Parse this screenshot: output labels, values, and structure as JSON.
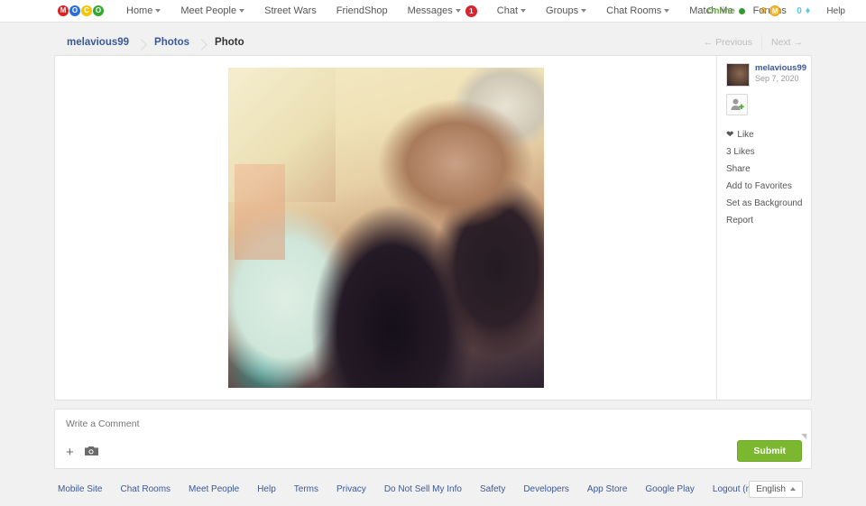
{
  "nav": {
    "logo": [
      {
        "letter": "M",
        "color": "#e02020"
      },
      {
        "letter": "O",
        "color": "#2b6fd6"
      },
      {
        "letter": "C",
        "color": "#f2c500"
      },
      {
        "letter": "O",
        "color": "#36a832"
      }
    ],
    "items": [
      {
        "label": "Home",
        "caret": true
      },
      {
        "label": "Meet People",
        "caret": true
      },
      {
        "label": "Street Wars",
        "caret": false
      },
      {
        "label": "FriendShop",
        "caret": false
      },
      {
        "label": "Messages",
        "caret": true,
        "badge": "1"
      },
      {
        "label": "Chat",
        "caret": true
      },
      {
        "label": "Groups",
        "caret": true
      },
      {
        "label": "Chat Rooms",
        "caret": true
      },
      {
        "label": "Match Me",
        "caret": false
      },
      {
        "label": "Forums",
        "caret": false
      }
    ],
    "status": {
      "online_label": "Online",
      "coins": "0",
      "coin_icon": "coin-icon",
      "gems": "0",
      "gem_icon": "diamond-icon",
      "help": "Help"
    }
  },
  "breadcrumb": {
    "items": [
      "melavious99",
      "Photos",
      "Photo"
    ]
  },
  "pager": {
    "previous": "← Previous",
    "next": "Next →"
  },
  "sidebar": {
    "poster_name": "melavious99",
    "poster_date": "Sep 7, 2020",
    "add_friend_icon": "add-friend-icon",
    "actions": [
      {
        "label": "Like",
        "icon": "heart-icon"
      },
      {
        "label": "3 Likes",
        "icon": ""
      },
      {
        "label": "Share",
        "icon": ""
      },
      {
        "label": "Add to Favorites",
        "icon": ""
      },
      {
        "label": "Set as Background",
        "icon": ""
      },
      {
        "label": "Report",
        "icon": ""
      }
    ]
  },
  "comment": {
    "placeholder": "Write a Comment",
    "value": "",
    "attach_icon": "plus-icon",
    "camera_icon": "camera-icon",
    "submit_label": "Submit"
  },
  "footer": {
    "links": [
      "Mobile Site",
      "Chat Rooms",
      "Meet People",
      "Help",
      "Terms",
      "Privacy",
      "Do Not Sell My Info",
      "Safety",
      "Developers",
      "App Store",
      "Google Play",
      "Logout (m1chael777)"
    ],
    "language": "English"
  },
  "colors": {
    "accent_blue": "#3b5998",
    "submit_green": "#7cb82f",
    "badge_red": "#d9232d",
    "online_green": "#2e9e2e"
  }
}
